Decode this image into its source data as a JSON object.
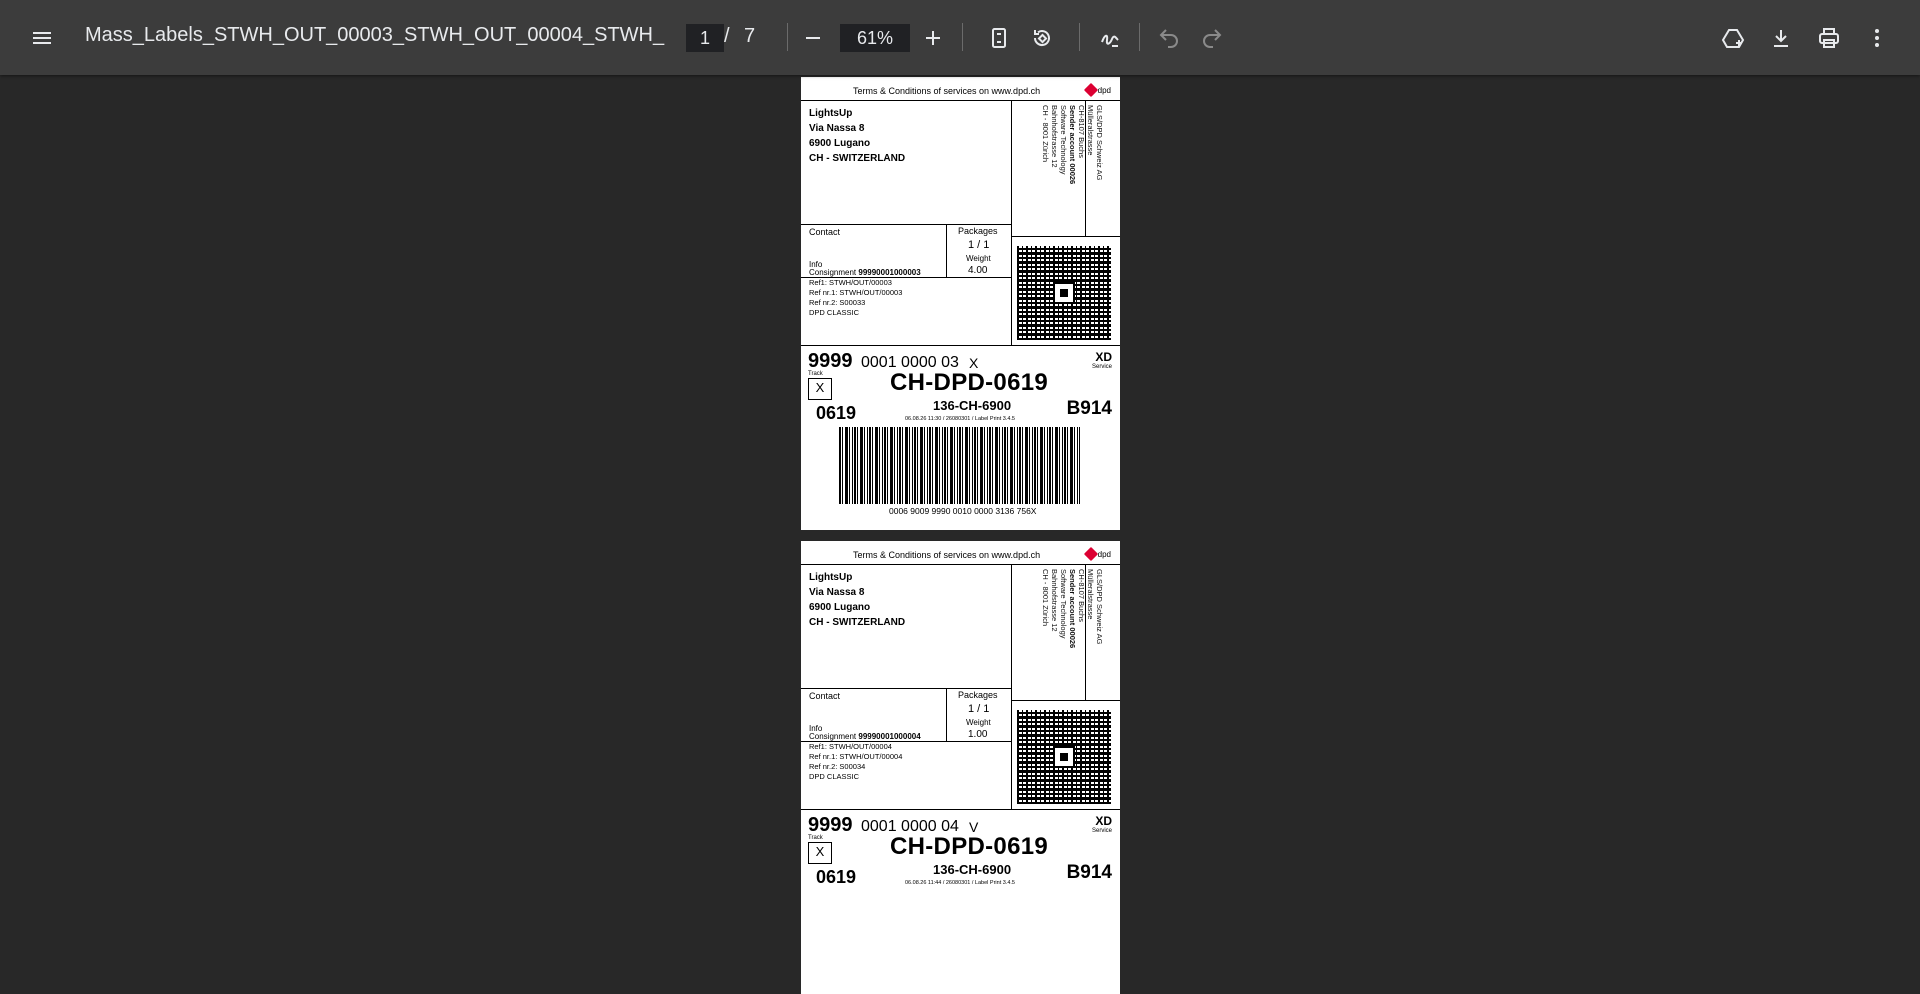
{
  "toolbar": {
    "title": "Mass_Labels_STWH_OUT_00003_STWH_OUT_00004_STWH_...",
    "page_current": "1",
    "page_sep": "/",
    "page_total": "7",
    "zoom": "61%"
  },
  "labels": [
    {
      "terms": "Terms & Conditions of services on www.dpd.ch",
      "logo_text": "dpd",
      "recipient": [
        "LightsUp",
        "Via Nassa 8",
        "6900 Lugano",
        "CH - SWITZERLAND"
      ],
      "sender": [
        "GLS/DPD Schweiz AG",
        "Mülleralstrasse",
        "CH-8107 Buchs",
        "Sender account 00026",
        "Software Technology",
        "Bahnhofstrasse 12",
        "CH - 8001 Zürich"
      ],
      "contact_label": "Contact",
      "packages_label": "Packages",
      "packages_value": "1 / 1",
      "weight_label": "Weight",
      "weight_value": "4.00",
      "info_label": "Info",
      "consignment_label": "Consignment",
      "consignment_value": "99990001000003",
      "refs": [
        "Ref1: STWH/OUT/00003",
        "Ref nr.1: STWH/OUT/00003",
        "Ref nr.2: S00033",
        "DPD CLASSIC"
      ],
      "track_big": "9999",
      "track_rest": "0001 0000 03",
      "track_check": "X",
      "track_label": "Track",
      "box_letter": "X",
      "service_code": "XD",
      "service_label": "Service",
      "route": "CH-DPD-0619",
      "depot": "0619",
      "sub_route": "136-CH-6900",
      "print_info": "06.08.26 11:30 / 26080301 / Label Print 3.4.5",
      "sort_code": "B914",
      "barcode_number": "0006 9009 9990 0010 0000 3136 756X"
    },
    {
      "terms": "Terms & Conditions of services on www.dpd.ch",
      "logo_text": "dpd",
      "recipient": [
        "LightsUp",
        "Via Nassa 8",
        "6900 Lugano",
        "CH - SWITZERLAND"
      ],
      "sender": [
        "GLS/DPD Schweiz AG",
        "Mülleralstrasse",
        "CH-8107 Buchs",
        "Sender account 00026",
        "Software Technology",
        "Bahnhofstrasse 12",
        "CH - 8001 Zürich"
      ],
      "contact_label": "Contact",
      "packages_label": "Packages",
      "packages_value": "1 / 1",
      "weight_label": "Weight",
      "weight_value": "1.00",
      "info_label": "Info",
      "consignment_label": "Consignment",
      "consignment_value": "99990001000004",
      "refs": [
        "Ref1: STWH/OUT/00004",
        "Ref nr.1: STWH/OUT/00004",
        "Ref nr.2: S00034",
        "DPD CLASSIC"
      ],
      "track_big": "9999",
      "track_rest": "0001 0000 04",
      "track_check": "V",
      "track_label": "Track",
      "box_letter": "X",
      "service_code": "XD",
      "service_label": "Service",
      "route": "CH-DPD-0619",
      "depot": "0619",
      "sub_route": "136-CH-6900",
      "print_info": "06.08.26 11:44 / 26080301 / Label Print 3.4.5",
      "sort_code": "B914",
      "barcode_number": ""
    }
  ]
}
